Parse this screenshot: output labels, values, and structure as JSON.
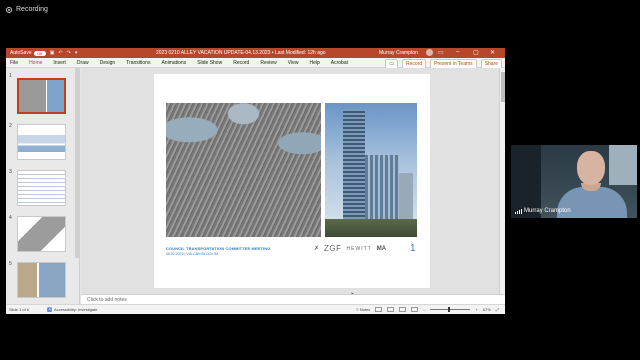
{
  "recording": {
    "label": "Recording"
  },
  "titlebar": {
    "autosave_label": "AutoSave",
    "autosave_state": "Off",
    "doc_title": "2023 0210 ALLEY VACATION UPDATE-04.13.2023 • Last Modified: 12h ago",
    "user": "Murray Crampton",
    "accent_color": "#b7472a"
  },
  "menu": {
    "items": [
      "File",
      "Home",
      "Insert",
      "Draw",
      "Design",
      "Transitions",
      "Animations",
      "Slide Show",
      "Record",
      "Review",
      "View",
      "Help",
      "Acrobat"
    ],
    "record_btn": "Record",
    "present_btn": "Present in Teams",
    "share_btn": "Share"
  },
  "thumbnails": {
    "numbers": [
      "1",
      "2",
      "3",
      "4",
      "5"
    ],
    "selected": "1"
  },
  "slide": {
    "meeting_title": "COUNCIL TRANSPORTATION COMMITTEE MEETING",
    "meeting_sub": "05.02.2023 | VULCAN BLOCK 84",
    "logo_zgf": "ZGF",
    "logo_hewitt": "HEWITT",
    "logo_ma": "MA",
    "page_number": "1"
  },
  "notes": {
    "placeholder": "Click to add notes"
  },
  "status": {
    "slide_info": "Slide 1 of 6",
    "accessibility": "Accessibility: Investigate",
    "notes_label": "Notes",
    "zoom": "67%"
  },
  "participant": {
    "name": "Murray Crampton"
  }
}
